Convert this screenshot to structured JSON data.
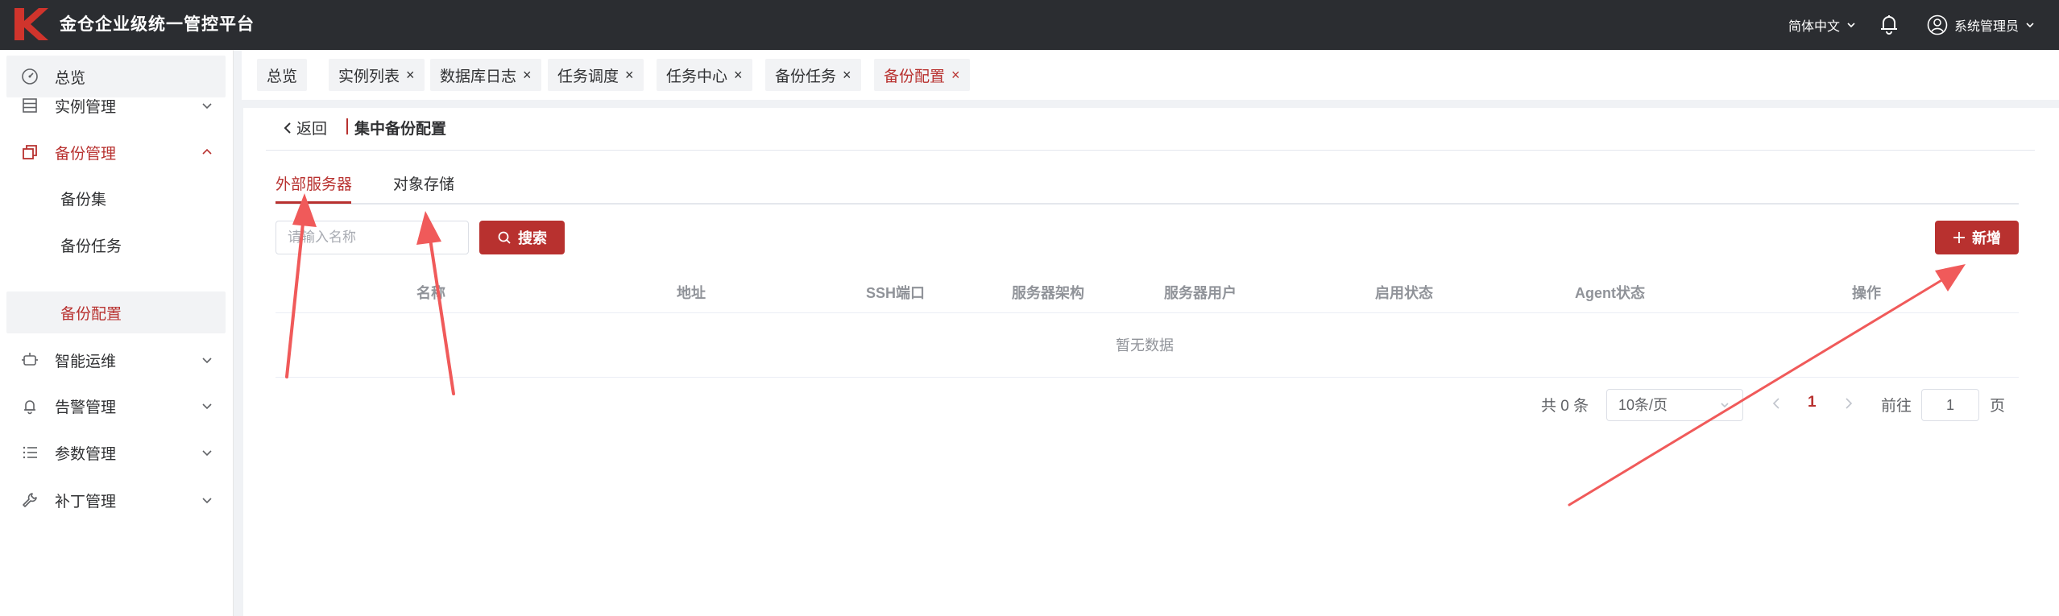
{
  "header": {
    "app_title": "金仓企业级统一管控平台",
    "language": "简体中文",
    "username": "系统管理员"
  },
  "sidebar": {
    "items": [
      {
        "label": "总览",
        "icon": "dashboard-icon"
      },
      {
        "label": "实例管理",
        "icon": "database-icon"
      },
      {
        "label": "备份管理",
        "icon": "copy-icon",
        "expanded": true
      },
      {
        "label": "备份集",
        "sub": true
      },
      {
        "label": "备份任务",
        "sub": true
      },
      {
        "label": "备份配置",
        "sub": true,
        "selected": true
      },
      {
        "label": "智能运维",
        "icon": "robot-icon"
      },
      {
        "label": "告警管理",
        "icon": "bell-icon"
      },
      {
        "label": "参数管理",
        "icon": "list-icon"
      },
      {
        "label": "补丁管理",
        "icon": "wrench-icon"
      }
    ]
  },
  "tags": [
    {
      "label": "总览"
    },
    {
      "label": "实例列表",
      "close": "×"
    },
    {
      "label": "数据库日志",
      "close": "×"
    },
    {
      "label": "任务调度",
      "close": "×"
    },
    {
      "label": "任务中心",
      "close": "×"
    },
    {
      "label": "备份任务",
      "close": "×"
    },
    {
      "label": "备份配置",
      "close": "×",
      "active": true
    }
  ],
  "page": {
    "back_label": "返回",
    "title": "集中备份配置",
    "tabs": [
      {
        "label": "外部服务器",
        "active": true
      },
      {
        "label": "对象存储"
      }
    ],
    "search_placeholder": "请输入名称",
    "search_button": "搜索",
    "add_button": "新增",
    "table": {
      "columns": [
        "名称",
        "地址",
        "SSH端口",
        "服务器架构",
        "服务器用户",
        "启用状态",
        "Agent状态",
        "操作"
      ],
      "rows": [],
      "empty_text": "暂无数据"
    },
    "pagination": {
      "total": "共 0 条",
      "page_size": "10条/页",
      "current_page": "1",
      "goto_label": "前往",
      "goto_value": "1",
      "goto_unit": "页"
    }
  },
  "colors": {
    "accent": "#b8312f",
    "topbar": "#2b2d31",
    "annotation_arrow": "#f05a5a"
  }
}
